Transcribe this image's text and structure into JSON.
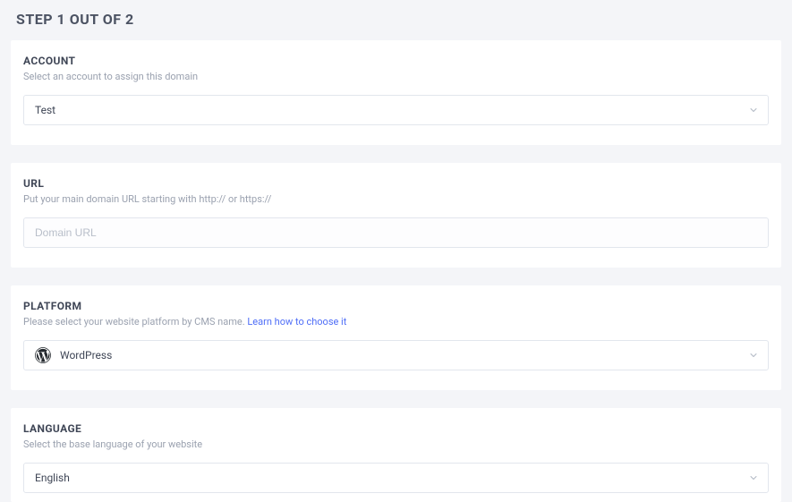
{
  "pageTitle": "STEP 1 OUT OF 2",
  "account": {
    "title": "ACCOUNT",
    "desc": "Select an account to assign this domain",
    "value": "Test"
  },
  "url": {
    "title": "URL",
    "desc": "Put your main domain URL starting with http:// or https://",
    "placeholder": "Domain URL"
  },
  "platform": {
    "title": "PLATFORM",
    "descPrefix": "Please select your website platform by CMS name. ",
    "learnLink": "Learn how to choose it",
    "value": "WordPress",
    "iconName": "wordpress-icon"
  },
  "language": {
    "title": "LANGUAGE",
    "desc": "Select the base language of your website",
    "value": "English"
  }
}
